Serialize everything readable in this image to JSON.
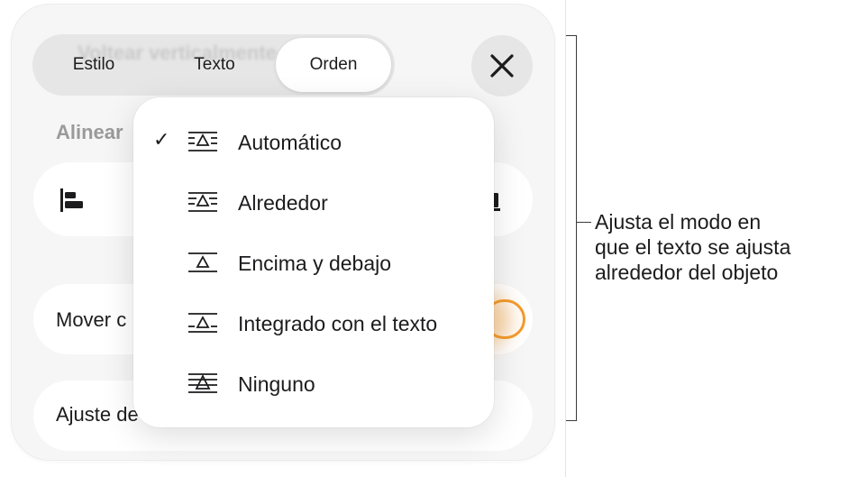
{
  "tabs": {
    "ghost_label": "Voltear verticalmente",
    "style": "Estilo",
    "text": "Texto",
    "order": "Orden",
    "selected": "Orden"
  },
  "close_icon": "close-icon",
  "align": {
    "label": "Alinear"
  },
  "mover_row": {
    "label": "Mover con texto",
    "visible_label": "Mover c",
    "toggle_on": true
  },
  "ajuste_row": {
    "label": "Ajuste de texto",
    "visible_label": "Ajuste de"
  },
  "wrap_menu": {
    "selected": "Automático",
    "items": [
      {
        "label": "Automático",
        "icon": "wrap-automatic-icon",
        "checked": true
      },
      {
        "label": "Alrededor",
        "icon": "wrap-around-icon",
        "checked": false
      },
      {
        "label": "Encima y debajo",
        "icon": "wrap-above-below-icon",
        "checked": false
      },
      {
        "label": "Integrado con el texto",
        "icon": "wrap-inline-icon",
        "checked": false
      },
      {
        "label": "Ninguno",
        "icon": "wrap-none-icon",
        "checked": false
      }
    ]
  },
  "check_glyph": "✓",
  "callout": {
    "lines": [
      "Ajusta el modo en",
      "que el texto se ajusta",
      "alrededor del objeto"
    ]
  },
  "colors": {
    "accent": "#f39a2c",
    "panel": "#f6f6f6",
    "row": "#ffffff"
  }
}
